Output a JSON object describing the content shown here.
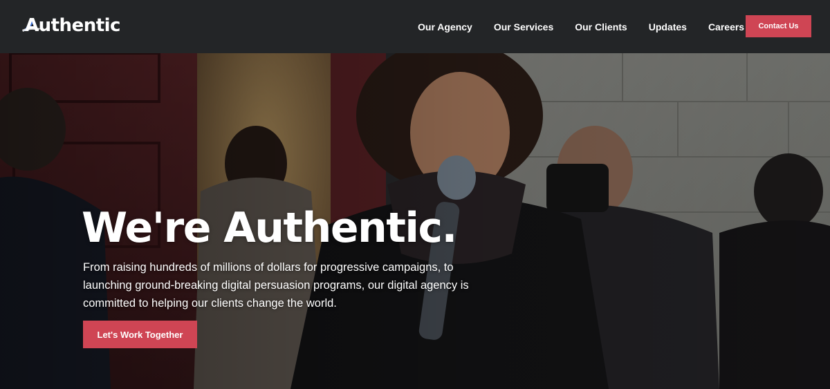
{
  "brand": {
    "name": "Authentic",
    "logo_icon": "authentic-swoosh-icon",
    "accent_color": "#cf4554",
    "header_bg": "#232527"
  },
  "nav": {
    "items": [
      {
        "label": "Our Agency"
      },
      {
        "label": "Our Services"
      },
      {
        "label": "Our Clients"
      },
      {
        "label": "Updates"
      },
      {
        "label": "Careers"
      }
    ],
    "contact_label": "Contact Us"
  },
  "hero": {
    "title": "We're Authentic.",
    "subtitle": "From raising hundreds of millions of dollars for progressive campaigns, to launching ground-breaking digital persuasion programs, our digital agency is committed to helping our clients change the world.",
    "cta_label": "Let's Work Together",
    "background": "photo-crowd-speaker-with-microphone"
  }
}
